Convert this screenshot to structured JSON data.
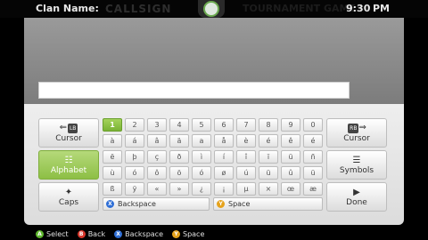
{
  "header": {
    "title": "Clan Name:",
    "ghost_value": "CALLSIGN",
    "ghost_right": "TOURNAMENT GAMES",
    "time": "9:30",
    "ampm": "PM"
  },
  "text_input": {
    "value": ""
  },
  "left_column": [
    {
      "label": "Cursor",
      "tag": "LB"
    },
    {
      "label": "Alphabet",
      "active": true
    },
    {
      "label": "Caps"
    }
  ],
  "right_column": [
    {
      "label": "Cursor",
      "tag": "RB"
    },
    {
      "label": "Symbols"
    },
    {
      "label": "Done"
    }
  ],
  "keys": [
    [
      "1",
      "2",
      "3",
      "4",
      "5",
      "6",
      "7",
      "8",
      "9",
      "0"
    ],
    [
      "à",
      "á",
      "â",
      "ä",
      "ã",
      "å",
      "è",
      "é",
      "ê",
      "ë"
    ],
    [
      "ë",
      "þ",
      "ç",
      "ð",
      "ì",
      "í",
      "î",
      "ï",
      "ü",
      "ñ"
    ],
    [
      "ù",
      "ó",
      "ô",
      "ö",
      "ó",
      "ø",
      "ú",
      "û",
      "ü",
      "ý"
    ],
    [
      "ß",
      "ÿ",
      "«",
      "»",
      "¿",
      "¡",
      "µ",
      "×",
      "œ",
      "æ"
    ]
  ],
  "keys_visible": [
    [
      "1",
      "2",
      "3",
      "4",
      "5",
      "6",
      "7",
      "8",
      "9",
      "0"
    ],
    [
      "à",
      "á",
      "â",
      "ä",
      "a",
      "å",
      "è",
      "é",
      "ê",
      "é"
    ],
    [
      "ë",
      "þ",
      "ç",
      "ð",
      "ì",
      "í",
      "î",
      "ï",
      "ü",
      "ñ"
    ],
    [
      "ù",
      "ó",
      "ô",
      "ö",
      "ó",
      "ø",
      "ú",
      "ü",
      "û",
      "ü"
    ],
    [
      "ß",
      "ÿ",
      "«",
      "»",
      "¿",
      "¡",
      "µ",
      "×",
      "œ",
      "æ"
    ]
  ],
  "bottom_buttons": {
    "backspace": "Backspace",
    "space": "Space"
  },
  "hints": [
    {
      "button": "A",
      "label": "Select",
      "color": "#5fb82e"
    },
    {
      "button": "B",
      "label": "Back",
      "color": "#d9362b"
    },
    {
      "button": "X",
      "label": "Backspace",
      "color": "#2f6fd6"
    },
    {
      "button": "Y",
      "label": "Space",
      "color": "#e5a21c"
    }
  ],
  "colors": {
    "accent": "#8dbf45"
  }
}
